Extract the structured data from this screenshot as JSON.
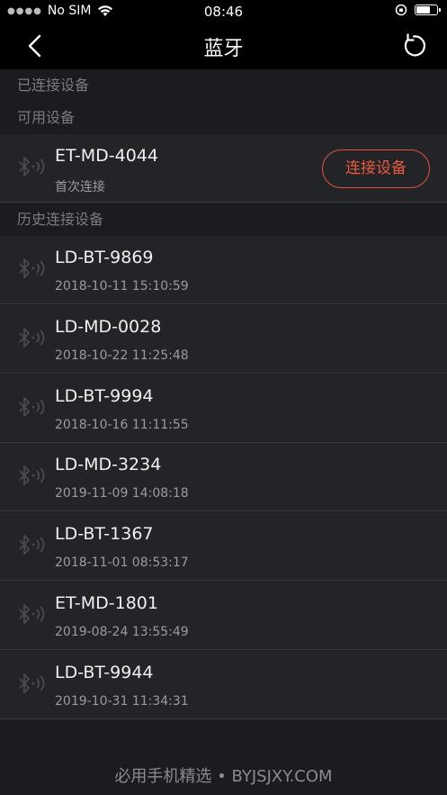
{
  "status_bar": {
    "carrier": "No SIM",
    "time": "08:46"
  },
  "nav": {
    "title": "蓝牙"
  },
  "sections": {
    "connected": "已连接设备",
    "available": "可用设备",
    "history": "历史连接设备"
  },
  "available_devices": [
    {
      "name": "ET-MD-4044",
      "sub": "首次连接",
      "action": "连接设备"
    }
  ],
  "history_devices": [
    {
      "name": "LD-BT-9869",
      "time": "2018-10-11 15:10:59"
    },
    {
      "name": "LD-MD-0028",
      "time": "2018-10-22 11:25:48"
    },
    {
      "name": "LD-BT-9994",
      "time": "2018-10-16 11:11:55"
    },
    {
      "name": "LD-MD-3234",
      "time": "2019-11-09 14:08:18"
    },
    {
      "name": "LD-BT-1367",
      "time": "2018-11-01 08:53:17"
    },
    {
      "name": "ET-MD-1801",
      "time": "2019-08-24 13:55:49"
    },
    {
      "name": "LD-BT-9944",
      "time": "2019-10-31 11:34:31"
    }
  ],
  "battery_level": 0.7,
  "watermark": "必用手机精选 • BYJSJXY.COM",
  "colors": {
    "accent": "#ee5a3c",
    "background": "#1b1c1f",
    "row": "#232427"
  }
}
